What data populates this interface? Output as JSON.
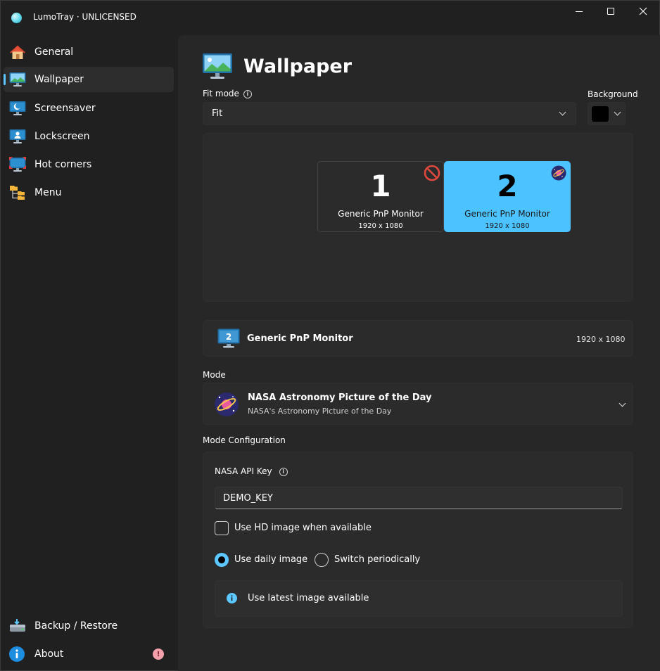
{
  "window": {
    "title": "LumoTray · UNLICENSED"
  },
  "sidebar": {
    "items": [
      {
        "label": "General",
        "icon": "home-icon"
      },
      {
        "label": "Wallpaper",
        "icon": "wallpaper-monitor-icon",
        "selected": true
      },
      {
        "label": "Screensaver",
        "icon": "screensaver-moon-icon"
      },
      {
        "label": "Lockscreen",
        "icon": "lockscreen-user-icon"
      },
      {
        "label": "Hot corners",
        "icon": "hot-corners-icon"
      },
      {
        "label": "Menu",
        "icon": "menu-folders-icon"
      }
    ],
    "footer_items": [
      {
        "label": "Backup / Restore",
        "icon": "backup-drive-icon"
      },
      {
        "label": "About",
        "icon": "info-circle-icon",
        "badge": "!"
      }
    ]
  },
  "page": {
    "title": "Wallpaper",
    "fit_mode_label": "Fit mode",
    "fit_mode_value": "Fit",
    "background_label": "Background",
    "background_color": "#000000"
  },
  "monitors": [
    {
      "number": "1",
      "name": "Generic PnP Monitor",
      "resolution": "1920 x 1080",
      "status_icon": "disabled-icon"
    },
    {
      "number": "2",
      "name": "Generic PnP Monitor",
      "resolution": "1920 x 1080",
      "status_icon": "nasa-apod-icon",
      "selected": true
    }
  ],
  "selected_monitor": {
    "number": "2",
    "name": "Generic PnP Monitor",
    "resolution": "1920 x 1080"
  },
  "mode": {
    "label": "Mode",
    "title": "NASA Astronomy Picture of the Day",
    "subtitle": "NASA's Astronomy Picture of the Day"
  },
  "mode_config": {
    "label": "Mode Configuration",
    "api_key_label": "NASA API Key",
    "api_key_value": "DEMO_KEY",
    "hd_checkbox_label": "Use HD image when available",
    "hd_checked": false,
    "radio_daily_label": "Use daily image",
    "radio_periodic_label": "Switch periodically",
    "selected_radio": "daily",
    "info_text": "Use latest image available"
  },
  "colors": {
    "accent": "#4cc2ff",
    "window_bg": "#202020",
    "content_bg": "#272727"
  }
}
